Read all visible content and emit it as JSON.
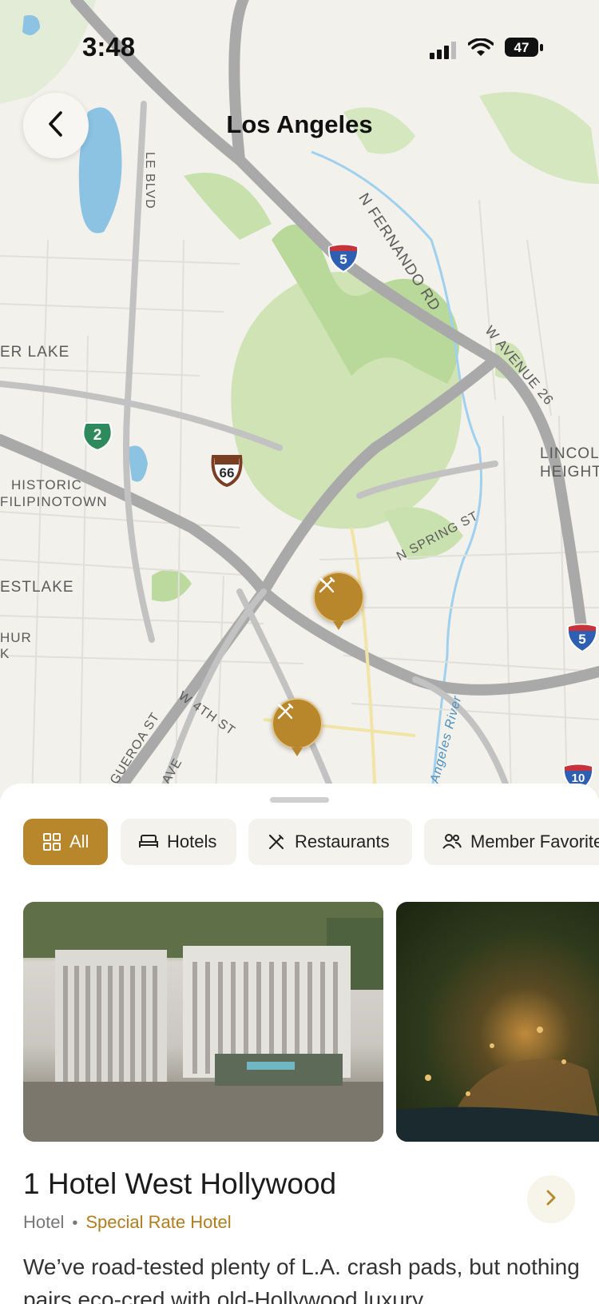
{
  "status_bar": {
    "time": "3:48",
    "battery": "47"
  },
  "header": {
    "title": "Los Angeles",
    "back_icon": "chevron-left-icon"
  },
  "map": {
    "labels": {
      "fernando_rd": "N FERNANDO RD",
      "blvd": "LE BLVD",
      "er_lake": "ER LAKE",
      "avenue26": "W AVENUE 26",
      "historic": "HISTORIC",
      "filipinotown": "FILIPINOTOWN",
      "lincoln1": "LINCOLN",
      "lincoln2": "HEIGHTS",
      "spring": "N SPRING ST",
      "estlake": "ESTLAKE",
      "hur": "HUR",
      "k": "K",
      "fourth": "W 4TH ST",
      "figueroa": "GUEROA ST",
      "ave": "AVE",
      "river": "Angeles River"
    },
    "shields": {
      "i5_top": "5",
      "i5_right": "5",
      "i10": "10",
      "ca2": "2",
      "us66": "66"
    },
    "pins": [
      {
        "icon": "fork-knife-icon"
      },
      {
        "icon": "fork-knife-icon"
      }
    ]
  },
  "filters": [
    {
      "label": "All",
      "icon": "grid-icon",
      "active": true
    },
    {
      "label": "Hotels",
      "icon": "bed-icon",
      "active": false
    },
    {
      "label": "Restaurants",
      "icon": "fork-knife-icon",
      "active": false
    },
    {
      "label": "Member Favorite",
      "icon": "people-icon",
      "active": false
    }
  ],
  "listing": {
    "name": "1 Hotel West Hollywood",
    "type": "Hotel",
    "badge": "Special Rate Hotel",
    "description": "We’ve road-tested plenty of L.A. crash pads, but nothing pairs eco-cred with old-Hollywood luxury"
  },
  "colors": {
    "accent": "#b8862b",
    "chip_bg": "#f4f2ec",
    "badge_text": "#b07d1f"
  }
}
